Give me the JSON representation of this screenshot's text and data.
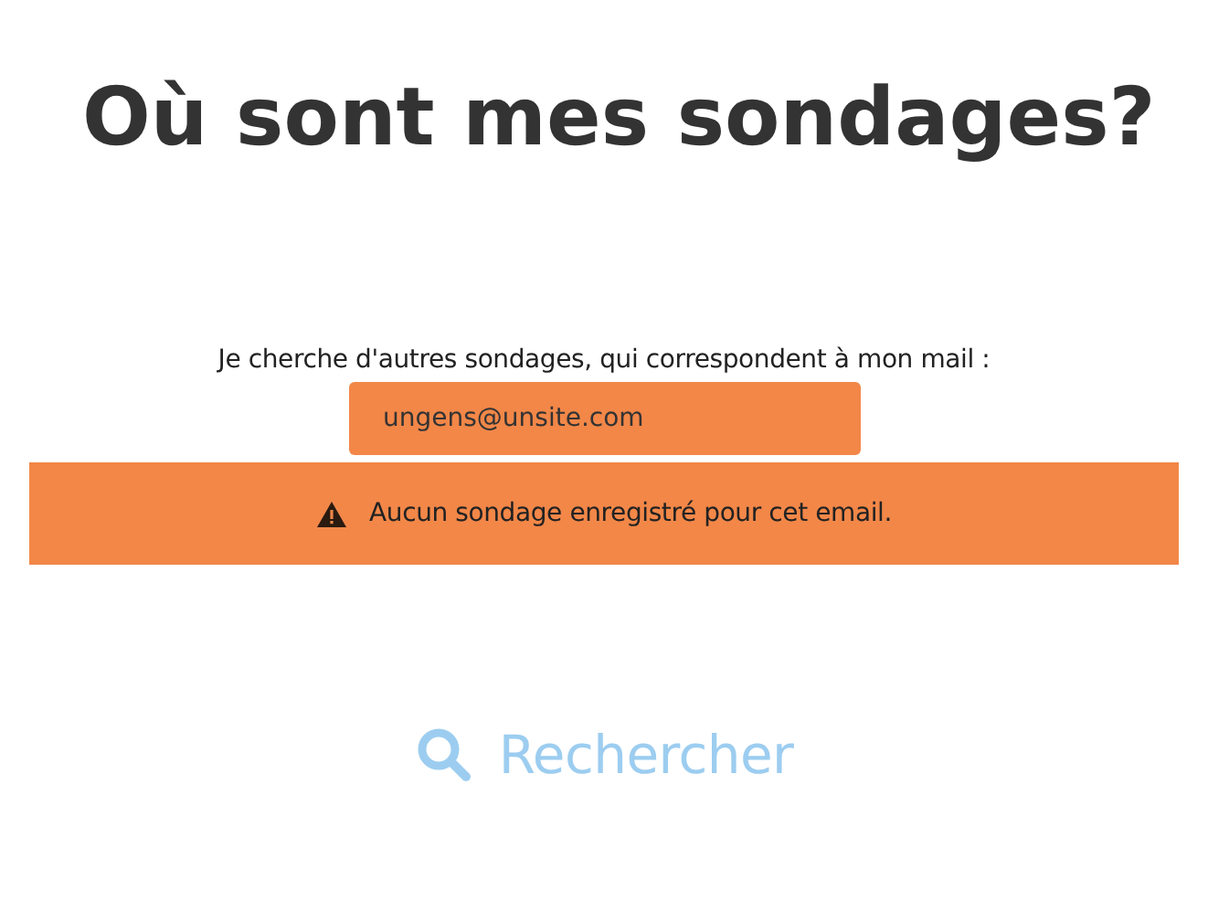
{
  "title": "Où sont mes sondages?",
  "email_label": "Je cherche d'autres sondages, qui correspondent à mon mail :",
  "email_field": {
    "value": "ungens@unsite.com"
  },
  "alert": {
    "message": "Aucun sondage enregistré pour cet email."
  },
  "search_button": {
    "label": "Rechercher"
  }
}
